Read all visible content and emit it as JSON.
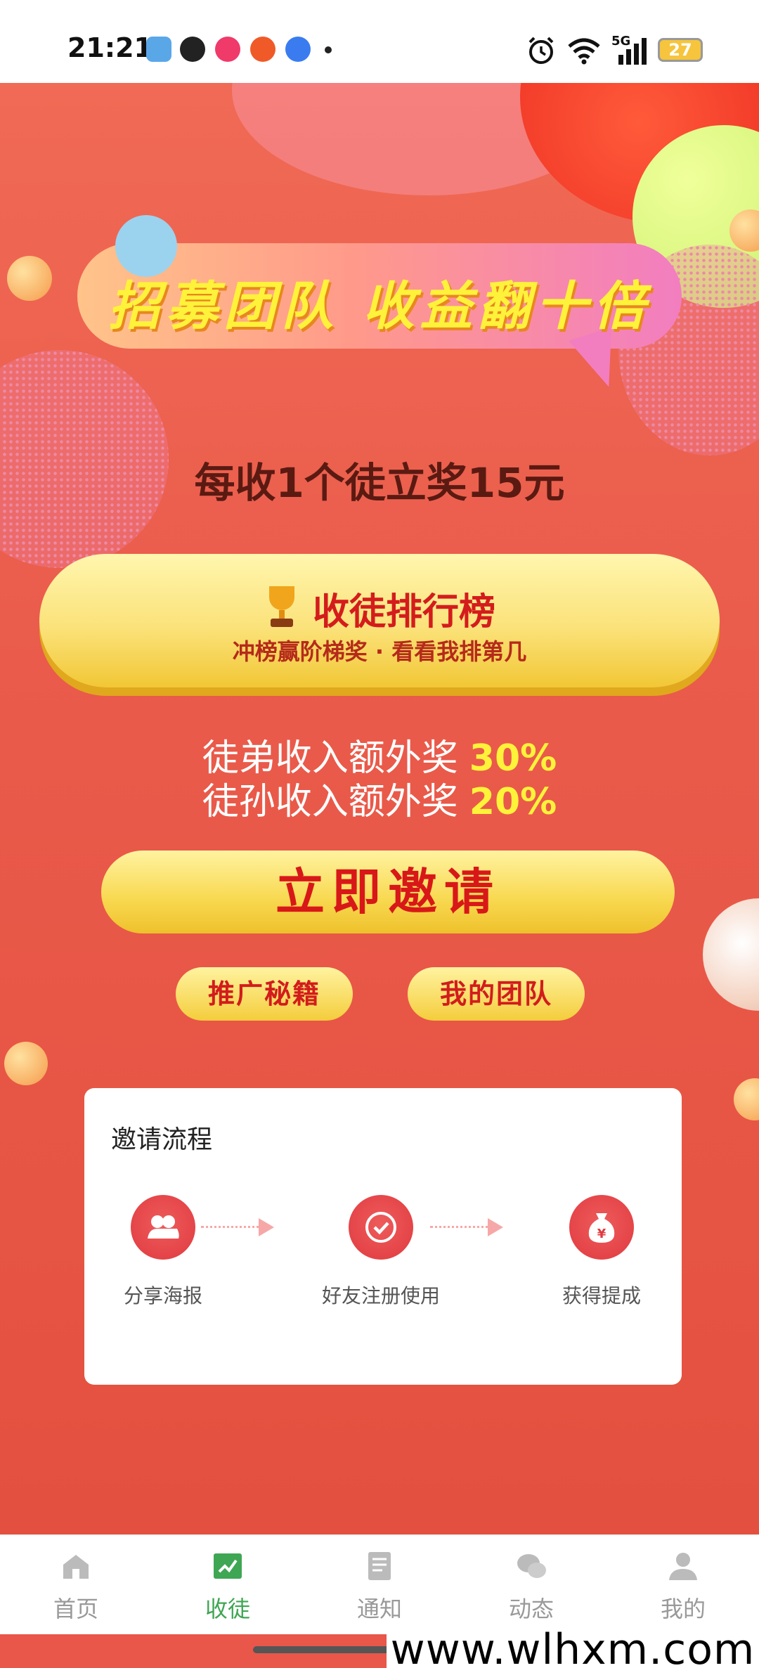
{
  "status_bar": {
    "time": "21:21",
    "battery": "27",
    "network": "5G"
  },
  "banner": {
    "title": "招募团队  收益翻十倍"
  },
  "headline": "每收1个徒立奖15元",
  "ranking_button": {
    "title": "收徒排行榜",
    "subtitle": "冲榜赢阶梯奖 · 看看我排第几",
    "icon": "trophy-icon"
  },
  "bonuses": [
    {
      "label": "徒弟收入额外奖",
      "percent": "30%"
    },
    {
      "label": "徒孙收入额外奖",
      "percent": "20%"
    }
  ],
  "invite_button": "立即邀请",
  "secondary_buttons": {
    "tips": "推广秘籍",
    "team": "我的团队"
  },
  "invite_process": {
    "title": "邀请流程",
    "steps": [
      {
        "label": "分享海报",
        "icon": "users-icon"
      },
      {
        "label": "好友注册使用",
        "icon": "check-icon"
      },
      {
        "label": "获得提成",
        "icon": "money-bag-icon"
      }
    ]
  },
  "bottom_nav": {
    "items": [
      {
        "label": "首页",
        "icon": "home-icon",
        "active": false
      },
      {
        "label": "收徒",
        "icon": "recruit-icon",
        "active": true
      },
      {
        "label": "通知",
        "icon": "document-icon",
        "active": false
      },
      {
        "label": "动态",
        "icon": "chat-icon",
        "active": false
      },
      {
        "label": "我的",
        "icon": "user-icon",
        "active": false
      }
    ]
  },
  "watermark": "www.wlhxm.com",
  "colors": {
    "background": "#e8574a",
    "accent_yellow": "#fff33a",
    "button_red_text": "#d41c1c",
    "nav_active": "#3fa653"
  }
}
